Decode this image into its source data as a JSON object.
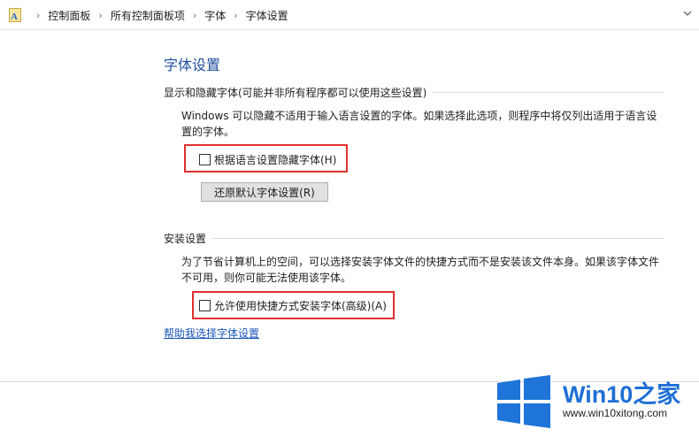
{
  "breadcrumb": {
    "items": [
      "控制面板",
      "所有控制面板项",
      "字体",
      "字体设置"
    ],
    "separator": "›"
  },
  "page": {
    "title": "字体设置"
  },
  "hide_section": {
    "heading": "显示和隐藏字体(可能并非所有程序都可以使用这些设置)",
    "description": "Windows 可以隐藏不适用于输入语言设置的字体。如果选择此选项，则程序中将仅列出适用于语言设置的字体。",
    "checkbox_label": "根据语言设置隐藏字体(H)",
    "restore_button": "还原默认字体设置(R)"
  },
  "install_section": {
    "heading": "安装设置",
    "description": "为了节省计算机上的空间，可以选择安装字体文件的快捷方式而不是安装该文件本身。如果该字体文件不可用，则你可能无法使用该字体。",
    "checkbox_label": "允许使用快捷方式安装字体(高级)(A)"
  },
  "help_link": "帮助我选择字体设置",
  "watermark": {
    "brand": "Win10",
    "brand_zh": "之家",
    "url": "www.win10xitong.com"
  },
  "colors": {
    "accent": "#1f4fa0",
    "highlight_box": "#e03030",
    "logo_blue": "#1f6fd6"
  },
  "icons": {
    "address": "font-folder-icon",
    "dropdown": "chevron-down-icon"
  }
}
